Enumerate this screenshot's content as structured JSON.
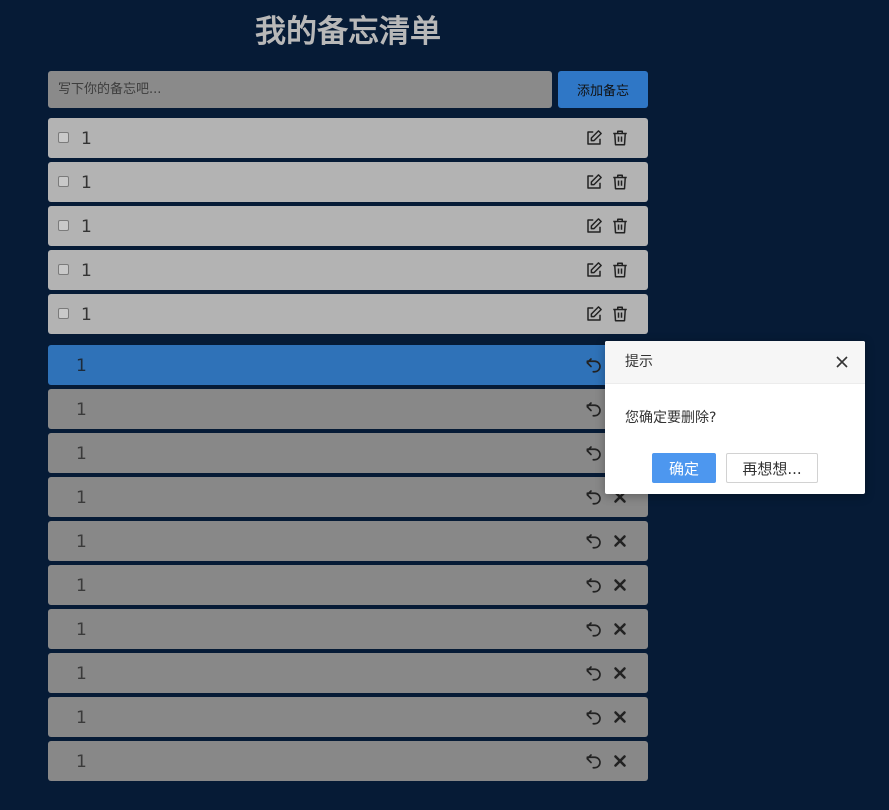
{
  "app": {
    "title": "我的备忘清单"
  },
  "add": {
    "placeholder": "写下你的备忘吧...",
    "button_label": "添加备忘"
  },
  "todos": [
    {
      "text": "1"
    },
    {
      "text": "1"
    },
    {
      "text": "1"
    },
    {
      "text": "1"
    },
    {
      "text": "1"
    }
  ],
  "done": [
    {
      "text": "1",
      "active": true
    },
    {
      "text": "1"
    },
    {
      "text": "1"
    },
    {
      "text": "1"
    },
    {
      "text": "1"
    },
    {
      "text": "1"
    },
    {
      "text": "1"
    },
    {
      "text": "1"
    },
    {
      "text": "1"
    },
    {
      "text": "1"
    }
  ],
  "dialog": {
    "title": "提示",
    "message": "您确定要删除?",
    "confirm_label": "确定",
    "cancel_label": "再想想..."
  },
  "colors": {
    "background": "#061b36",
    "todo_row": "#b3b3b3",
    "done_row": "#888888",
    "active_row": "#2f72b8",
    "primary": "#4d97ef"
  },
  "icons": {
    "todo_actions": [
      "edit-icon",
      "trash-icon"
    ],
    "done_actions": [
      "undo-icon",
      "close-icon"
    ]
  }
}
